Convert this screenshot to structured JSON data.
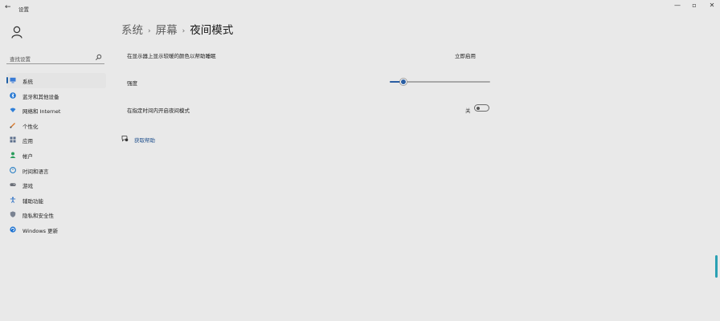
{
  "window": {
    "title": "设置"
  },
  "sidebar": {
    "search_placeholder": "查找设置",
    "items": [
      {
        "label": "系统",
        "icon": "monitor-icon"
      },
      {
        "label": "蓝牙和其他设备",
        "icon": "bluetooth-icon"
      },
      {
        "label": "网络和 Internet",
        "icon": "wifi-icon"
      },
      {
        "label": "个性化",
        "icon": "brush-icon"
      },
      {
        "label": "应用",
        "icon": "apps-icon"
      },
      {
        "label": "帐户",
        "icon": "person-icon"
      },
      {
        "label": "时间和语言",
        "icon": "globe-clock-icon"
      },
      {
        "label": "游戏",
        "icon": "gamepad-icon"
      },
      {
        "label": "辅助功能",
        "icon": "accessibility-icon"
      },
      {
        "label": "隐私和安全性",
        "icon": "shield-icon"
      },
      {
        "label": "Windows 更新",
        "icon": "update-icon"
      }
    ]
  },
  "breadcrumb": {
    "level1": "系统",
    "level2": "屏幕",
    "current": "夜间模式",
    "separator": "›"
  },
  "night_light": {
    "row1_label": "在显示器上显示较暖的颜色以帮助睡眠",
    "apply_label": "立即启用",
    "strength_label": "强度",
    "strength_value": 0.13,
    "schedule_label": "在指定时间内开启夜间模式",
    "schedule_state": "关",
    "help_label": "获取帮助"
  },
  "colors": {
    "accent": "#2a5ea3",
    "background": "#e9e9e9"
  }
}
